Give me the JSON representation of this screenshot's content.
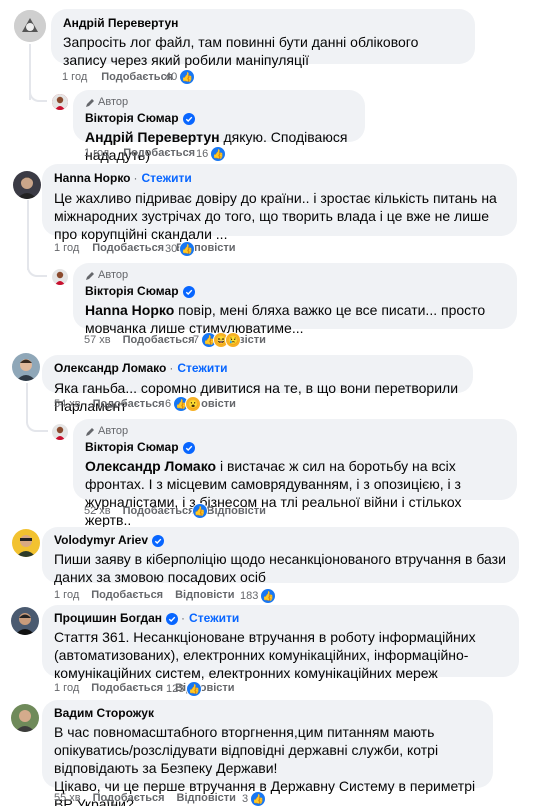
{
  "comments": [
    {
      "name": "Андрій Перевертун",
      "text": "Запросіть лог файл, там повинні бути данні облікового запису через який робили маніпуляції",
      "time": "1 год",
      "like": "Подобається",
      "count": "40"
    },
    {
      "author_badge": "Автор",
      "name": "Вікторія Сюмар",
      "mention": "Андрій Перевертун",
      "text": " дякую. Сподіваюся нададуть)",
      "time": "1 год",
      "like": "Подобається",
      "count": "16"
    },
    {
      "name": "Hanna Норко",
      "follow": "Стежити",
      "text": "Це жахливо підриває довіру до країни.. і зростає кількість питань на міжнародних зустрічах до того, що творить влада і це вже не лише про корупційні скандали ...",
      "time": "1 год",
      "like": "Подобається",
      "reply": "Відповісти",
      "count": "30"
    },
    {
      "author_badge": "Автор",
      "name": "Вікторія Сюмар",
      "mention": "Hanna Норко",
      "text": " повір, мені бляха важко це все писати... просто мовчанка лише стимулюватиме...",
      "time": "57 хв",
      "like": "Подобається",
      "reply": "Відповісти",
      "count": "7"
    },
    {
      "name": "Олександр Ломако",
      "follow": "Стежити",
      "text": "Яка ганьба... соромно дивитися на те, в що вони перетворили Парламент",
      "time": "54 хв",
      "like": "Подобається",
      "reply": "Відповісти",
      "count": "6"
    },
    {
      "author_badge": "Автор",
      "name": "Вікторія Сюмар",
      "mention": "Олександр Ломако",
      "text": " і вистачає ж сил на боротьбу на всіх фронтах. І з місцевим самоврядуванням, і з опозицією, і з журналістами, і з бізнесом на тлі реальної війни і стількох жертв..",
      "time": "52 хв",
      "like": "Подобається",
      "reply": "Відповісти"
    },
    {
      "name": "Volodymyr Ariev",
      "text": "Пиши заяву в кіберполіцію щодо несанкціонованого втручання в бази даних за змовою посадових осіб",
      "time": "1 год",
      "like": "Подобається",
      "reply": "Відповісти",
      "count": "183"
    },
    {
      "name": "Процишин Богдан",
      "follow": "Стежити",
      "text": "Стаття 361. Несанкціоноване втручання в роботу інформаційних (автоматизованих), електронних комунікаційних, інформаційно-комунікаційних систем, електронних комунікаційних мереж",
      "time": "1 год",
      "like": "Подобається",
      "reply": "Відповісти",
      "count": "123"
    },
    {
      "name": "Вадим Сторожук",
      "text": "В час повномасштабного вторгнення,цим питанням мають опікуватись/розслідувати відповідні державні служби, котрі відповідають за Безпеку Держави!\nЦікаво, чи це перше втручання в Державну Систему в периметрі ВР України?",
      "time": "55 хв",
      "like": "Подобається",
      "reply": "Відповісти",
      "count": "3"
    }
  ],
  "separator": "·",
  "colors": {
    "link": "#0866ff",
    "bubble": "#f0f2f5",
    "meta": "#65676b",
    "like_blue": "#1877f2"
  }
}
